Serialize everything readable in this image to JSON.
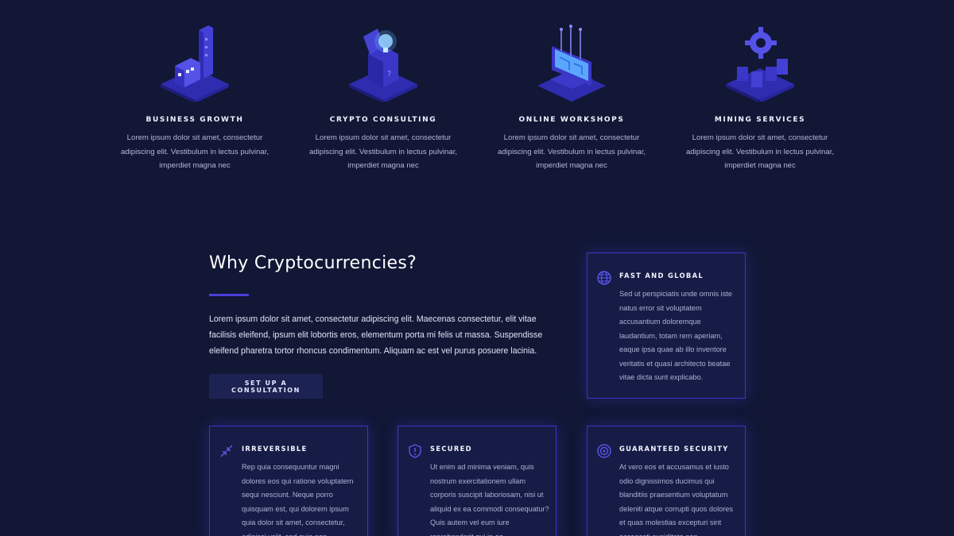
{
  "services": [
    {
      "title": "BUSINESS GROWTH",
      "text": "Lorem ipsum dolor sit amet, consectetur adipiscing elit. Vestibulum in lectus pulvinar, imperdiet magna nec",
      "icon": "business-growth-icon"
    },
    {
      "title": "CRYPTO CONSULTING",
      "text": "Lorem ipsum dolor sit amet, consectetur adipiscing elit. Vestibulum in lectus pulvinar, imperdiet magna nec",
      "icon": "crypto-consulting-icon"
    },
    {
      "title": "ONLINE WORKSHOPS",
      "text": "Lorem ipsum dolor sit amet, consectetur adipiscing elit. Vestibulum in lectus pulvinar, imperdiet magna nec",
      "icon": "online-workshops-icon"
    },
    {
      "title": "MINING SERVICES",
      "text": "Lorem ipsum dolor sit amet, consectetur adipiscing elit. Vestibulum in lectus pulvinar, imperdiet magna nec",
      "icon": "mining-services-icon"
    }
  ],
  "why": {
    "title": "Why Cryptocurrencies?",
    "body": "Lorem ipsum dolor sit amet, consectetur adipiscing elit. Maecenas consectetur, elit vitae facilisis eleifend, ipsum elit lobortis eros, elementum porta mi felis ut massa. Suspendisse eleifend pharetra tortor rhoncus condimentum. Aliquam ac est vel purus posuere lacinia.",
    "cta_label": "SET UP A CONSULTATION"
  },
  "features": [
    {
      "title": "FAST AND GLOBAL",
      "text": "Sed ut perspiciatis unde omnis iste natus error sit voluptatem accusantium doloremque laudantium, totam rem aperiam, eaque ipsa quae ab illo inventore veritatis et quasi architecto beatae vitae dicta sunt explicabo.",
      "icon": "globe-icon"
    },
    {
      "title": "IRREVERSIBLE",
      "text": "Rep quia consequuntur magni dolores eos qui ratione voluptatem sequi nesciunt. Neque porro quisquam est, qui dolorem ipsum quia dolor sit amet, consectetur, adipisci velit, sed quia non",
      "icon": "collapse-arrows-icon"
    },
    {
      "title": "SECURED",
      "text": "Ut enim ad minima veniam, quis nostrum exercitationem ullam corporis suscipit laboriosam, nisi ut aliquid ex ea commodi consequatur? Quis autem vel eum iure reprehenderit qui in ea",
      "icon": "shield-alert-icon"
    },
    {
      "title": "GUARANTEED SECURITY",
      "text": "At vero eos et accusamus et iusto odio dignissimos ducimus qui blanditiis praesentium voluptatum deleniti atque corrupti quos dolores et quas molestias excepturi sint occaecati cupiditate non",
      "icon": "target-icon"
    }
  ],
  "colors": {
    "background": "#111735",
    "accent": "#4a3fd8",
    "card": "#161c45",
    "card_border": "#3b36c6"
  }
}
